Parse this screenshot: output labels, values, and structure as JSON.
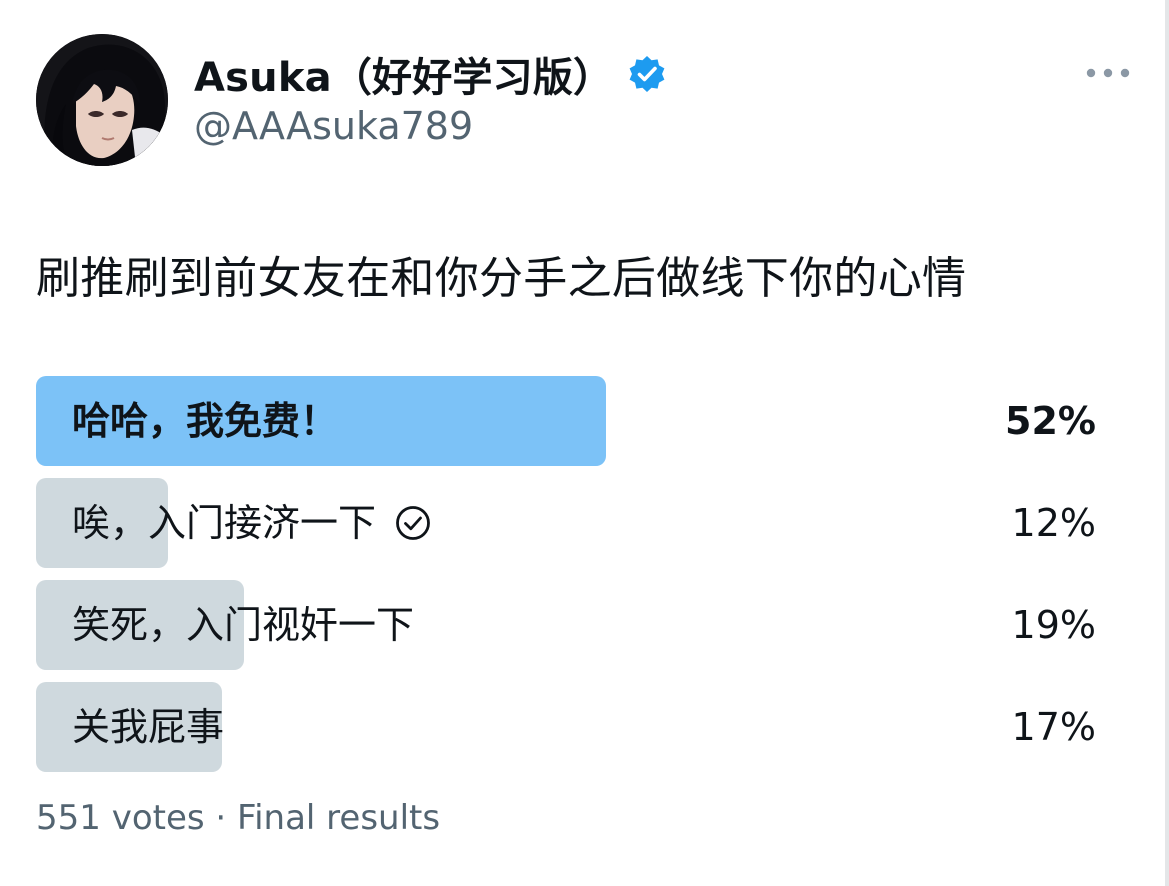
{
  "author": {
    "display_name": "Asuka（好好学习版）",
    "handle": "@AAAsuka789",
    "verified": true,
    "avatar_icon": "anime-girl-avatar",
    "verified_icon": "verified-badge-icon",
    "more_icon": "more-options-icon"
  },
  "tweet": {
    "text": "刷推刷到前女友在和你分手之后做线下你的心情"
  },
  "poll": {
    "options": [
      {
        "label": "哈哈，我免费！",
        "percent": 52,
        "percent_label": "52%",
        "winner": true,
        "selected": false
      },
      {
        "label": "唉，入门接济一下",
        "percent": 12,
        "percent_label": "12%",
        "winner": false,
        "selected": true
      },
      {
        "label": "笑死，入门视奸一下",
        "percent": 19,
        "percent_label": "19%",
        "winner": false,
        "selected": false
      },
      {
        "label": "关我屁事",
        "percent": 17,
        "percent_label": "17%",
        "winner": false,
        "selected": false
      }
    ],
    "footer": "551 votes · Final results"
  },
  "colors": {
    "winner_bar": "#7cc2f7",
    "other_bar": "#cfd9de",
    "verified_blue": "#1d9bf0",
    "secondary_text": "#536471",
    "primary_text": "#0f1419"
  }
}
